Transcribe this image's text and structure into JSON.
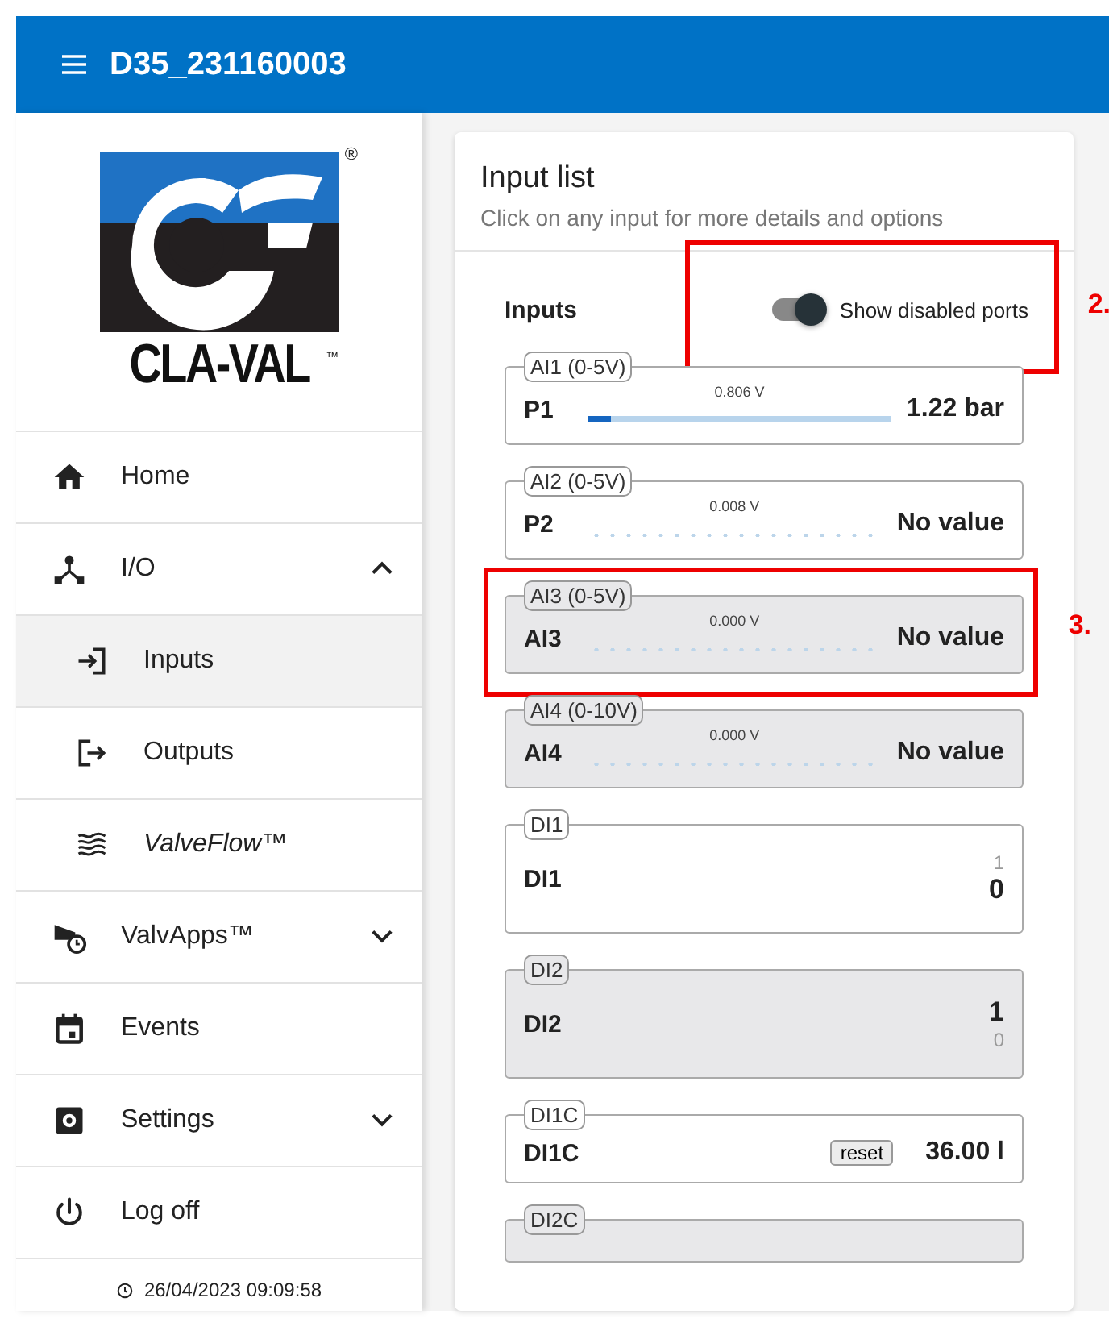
{
  "app_bar": {
    "title": "D35_231160003"
  },
  "logo": {
    "text": "CLA-VAL",
    "trademark": "™",
    "registered": "®"
  },
  "sidebar": {
    "items": [
      {
        "label": "Home",
        "kind": "home",
        "selected": false
      },
      {
        "label": "I/O",
        "kind": "io",
        "selected": false,
        "expanded": true,
        "children": [
          {
            "label": "Inputs",
            "kind": "login",
            "selected": true,
            "italic": false
          },
          {
            "label": "Outputs",
            "kind": "logout",
            "selected": false,
            "italic": false
          },
          {
            "label": "ValveFlow™",
            "kind": "waves",
            "selected": false,
            "italic": true
          }
        ]
      },
      {
        "label": "ValvApps™",
        "kind": "apps",
        "selected": false,
        "expanded": false
      },
      {
        "label": "Events",
        "kind": "calendar",
        "selected": false
      },
      {
        "label": "Settings",
        "kind": "settings",
        "selected": false,
        "expanded": false
      },
      {
        "label": "Log off",
        "kind": "power",
        "selected": false
      }
    ],
    "timestamp": "26/04/2023 09:09:58"
  },
  "card": {
    "title": "Input list",
    "subtitle": "Click on any input for more details and options",
    "section_label": "Inputs",
    "toggle": {
      "label": "Show disabled ports",
      "on": true,
      "annotation": "2."
    },
    "inputs": [
      {
        "kind": "analog",
        "tag": "AI1 (0-5V)",
        "name": "P1",
        "voltage": "0.806 V",
        "level": 0.075,
        "value": "1.22 bar",
        "disabled": false
      },
      {
        "kind": "analog",
        "tag": "AI2 (0-5V)",
        "name": "P2",
        "voltage": "0.008 V",
        "value": "No value",
        "disabled": false
      },
      {
        "kind": "analog",
        "tag": "AI3 (0-5V)",
        "name": "AI3",
        "voltage": "0.000 V",
        "value": "No value",
        "disabled": true,
        "annotation": "3."
      },
      {
        "kind": "analog",
        "tag": "AI4 (0-10V)",
        "name": "AI4",
        "voltage": "0.000 V",
        "value": "No value",
        "disabled": true
      },
      {
        "kind": "digital",
        "tag": "DI1",
        "name": "DI1",
        "high": "1",
        "low": "0",
        "on": false,
        "disabled": false
      },
      {
        "kind": "digital",
        "tag": "DI2",
        "name": "DI2",
        "high": "1",
        "low": "0",
        "on": true,
        "disabled": true
      },
      {
        "kind": "counter",
        "tag": "DI1C",
        "name": "DI1C",
        "button": "reset",
        "value": "36.00 l",
        "disabled": false
      },
      {
        "kind": "counter",
        "tag": "DI2C",
        "disabled": true
      }
    ]
  }
}
